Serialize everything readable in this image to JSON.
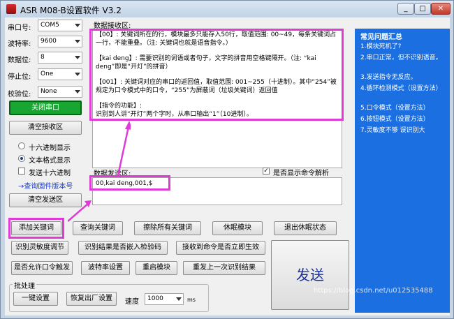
{
  "title": "ASR M08-B设置软件 V3.2",
  "titlebar_buttons": {
    "min": "_",
    "max": "□",
    "close": "✕"
  },
  "serial": {
    "port_label": "串口号:",
    "port_value": "COM5",
    "baud_label": "波特率:",
    "baud_value": "9600",
    "databits_label": "数据位:",
    "databits_value": "8",
    "stopbits_label": "停止位:",
    "stopbits_value": "One",
    "parity_label": "校验位:",
    "parity_value": "None"
  },
  "close_port_button": "关闭串口",
  "clear_receive_button": "清空接收区",
  "display_options": {
    "hex": "十六进制显示",
    "text": "文本格式显示",
    "send_hex": "发送十六进制"
  },
  "query_firmware_link": "→查询固件版本号",
  "clear_send_button": "清空发送区",
  "receive": {
    "label": "数据接收区:",
    "p1": "【00】: 关键词所在的行，模块最多只能存入50行，取值范围: 00~49，每条关键词占一行，不能重叠。（注: 关键词也就是语音指令。）",
    "p2": "【kai deng】: 需要识别的词语或者句子，文字的拼音用空格键隔开。（注: “kai deng”即是“开灯”的拼音）",
    "p3": "【001】: 关键词对应的串口的返回值，取值范围: 001~255（十进制）。其中“254”被规定为口令模式中的口令，“255”为屏蔽词（垃圾关键词）返回值",
    "p4": "【指令的功能】:",
    "p5": "识别到人讲“开灯”两个字时，从串口输出“1”（10进制）。"
  },
  "send": {
    "label": "数据发送区:",
    "value": "00,kai deng,001,$",
    "show_parse_label": "是否显示命令解析",
    "show_parse_checked": "✓"
  },
  "buttons": {
    "add_keyword": "添加关键词",
    "query_keyword": "查询关键词",
    "erase_all": "擦除所有关键词",
    "sleep": "休眠模块",
    "exit_sleep": "退出休眠状态",
    "sensitivity": "识别灵敏度调节",
    "embed_code": "识别结果是否嵌入检验码",
    "immediate": "接收到命令是否立即生效",
    "password": "是否允许口令触发",
    "baud_set": "波特率设置",
    "restart": "重启模块",
    "resend_last": "重发上一次识别结果",
    "send": "发送"
  },
  "batch": {
    "label": "批处理",
    "one_key": "一键设置",
    "factory": "恢复出厂设置",
    "speed_label": "速度",
    "speed_value": "1000",
    "speed_unit": "ms"
  },
  "faq": {
    "title": "常见问题汇总",
    "items": [
      "1.模块死机了?",
      "2.串口正常，但不识别语音。",
      "3.发送指令无反应。",
      "4.循环检测模式（设置方法）",
      "5.口令模式（设置方法）",
      "6.按钮模式（设置方法）",
      "7.灵敏度不够 误识别大"
    ]
  },
  "watermark": "https://blog.csdn.net/u012535488",
  "colors": {
    "accent_pink": "#df3bd6",
    "faq_blue": "#1c6fe0",
    "port_green": "#19a531"
  }
}
